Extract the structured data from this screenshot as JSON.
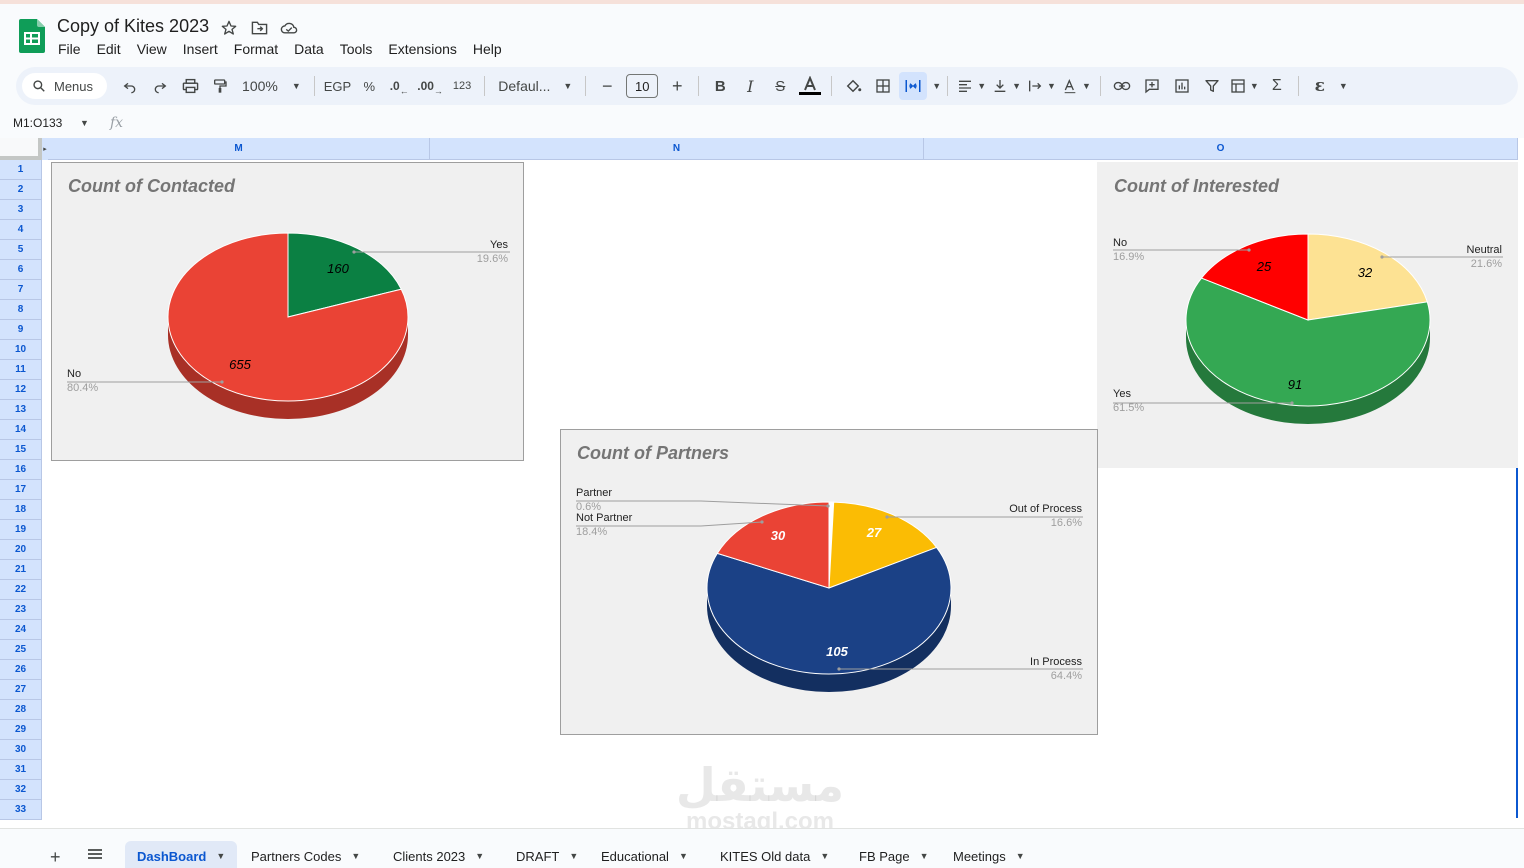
{
  "document": {
    "title": "Copy of Kites 2023"
  },
  "menu": [
    "File",
    "Edit",
    "View",
    "Insert",
    "Format",
    "Data",
    "Tools",
    "Extensions",
    "Help"
  ],
  "toolbar": {
    "search_label": "Menus",
    "zoom": "100%",
    "currency": "EGP",
    "percent": "%",
    "dec_decrease": ".0",
    "dec_increase": ".00",
    "number_format": "123",
    "font": "Defaul...",
    "font_size": "10"
  },
  "formula_bar": {
    "range": "M1:O133",
    "fx": "fx"
  },
  "columns": [
    "M",
    "N",
    "O"
  ],
  "rows": [
    "1",
    "2",
    "3",
    "4",
    "5",
    "6",
    "7",
    "8",
    "9",
    "10",
    "11",
    "12",
    "13",
    "14",
    "15",
    "16",
    "17",
    "18",
    "19",
    "20",
    "21",
    "22",
    "23",
    "24",
    "25",
    "26",
    "27",
    "28",
    "29",
    "30",
    "31",
    "32",
    "33"
  ],
  "charts": {
    "contacted": {
      "title": "Count of Contacted",
      "yes_label": "Yes",
      "yes_pct": "19.6%",
      "yes_value": "160",
      "no_label": "No",
      "no_pct": "80.4%",
      "no_value": "655"
    },
    "interested": {
      "title": "Count of Interested",
      "no_label": "No",
      "no_pct": "16.9%",
      "no_value": "25",
      "neutral_label": "Neutral",
      "neutral_pct": "21.6%",
      "neutral_value": "32",
      "yes_label": "Yes",
      "yes_pct": "61.5%",
      "yes_value": "91"
    },
    "partners": {
      "title": "Count of Partners",
      "partner_label": "Partner",
      "partner_pct": "0.6%",
      "notpartner_label": "Not Partner",
      "notpartner_pct": "18.4%",
      "notpartner_value": "30",
      "outofprocess_label": "Out of Process",
      "outofprocess_pct": "16.6%",
      "outofprocess_value": "27",
      "inprocess_label": "In Process",
      "inprocess_pct": "64.4%",
      "inprocess_value": "105"
    }
  },
  "chart_data": [
    {
      "type": "pie",
      "title": "Count of Contacted",
      "categories": [
        "Yes",
        "No"
      ],
      "values": [
        160,
        655
      ],
      "percent": [
        19.6,
        80.4
      ],
      "colors": [
        "#0b8043",
        "#ea4335"
      ]
    },
    {
      "type": "pie",
      "title": "Count of Interested",
      "categories": [
        "Neutral",
        "Yes",
        "No"
      ],
      "values": [
        32,
        91,
        25
      ],
      "percent": [
        21.6,
        61.5,
        16.9
      ],
      "colors": [
        "#fde293",
        "#34a853",
        "#ff0000"
      ]
    },
    {
      "type": "pie",
      "title": "Count of Partners",
      "categories": [
        "Partner",
        "Out of Process",
        "In Process",
        "Not Partner"
      ],
      "values": [
        1,
        27,
        105,
        30
      ],
      "percent": [
        0.6,
        16.6,
        64.4,
        18.4
      ],
      "colors": [
        "#ffffff",
        "#fbbc04",
        "#1b4186",
        "#ea4335"
      ]
    }
  ],
  "sheet_tabs": [
    "DashBoard",
    "Partners Codes",
    "Clients 2023",
    "DRAFT",
    "Educational",
    "KITES Old data",
    "FB Page",
    "Meetings"
  ],
  "watermark": {
    "arabic": "مستقل",
    "latin": "mostaql.com"
  },
  "colors": {
    "accent": "#0b57d0",
    "header_fill": "#d3e3fd",
    "sheets_green": "#0f9d58"
  }
}
